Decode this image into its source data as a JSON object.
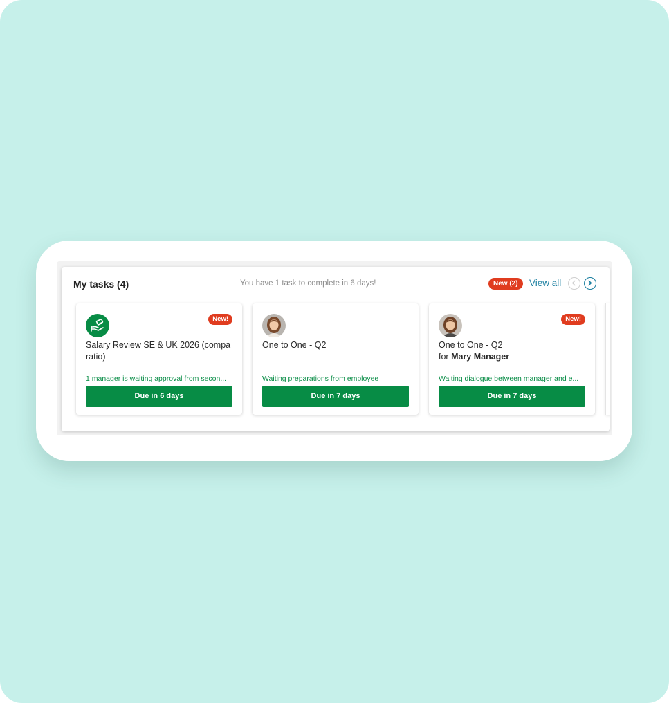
{
  "tasks": {
    "title": "My tasks (4)",
    "subtitle": "You have 1 task to complete in 6 days!",
    "new_badge": "New (2)",
    "view_all": "View all",
    "cards": [
      {
        "new": "New!",
        "title": "Salary Review SE & UK 2026 (compa ratio)",
        "title_line2_prefix": "",
        "title_line2_name": "",
        "status": "1 manager is waiting approval from secon...",
        "due": "Due in 6 days",
        "icon": "salary-hand-icon"
      },
      {
        "new": "",
        "title": "One to One - Q2",
        "title_line2_prefix": "",
        "title_line2_name": "",
        "status": "Waiting preparations from employee",
        "due": "Due in 7 days",
        "icon": "avatar"
      },
      {
        "new": "New!",
        "title": "One to One - Q2",
        "title_line2_prefix": "for ",
        "title_line2_name": "Mary Manager",
        "status": "Waiting dialogue between manager and e...",
        "due": "Due in 7 days",
        "icon": "avatar"
      }
    ]
  },
  "colors": {
    "background": "#c6f0ea",
    "accent_green": "#078c45",
    "badge_red": "#e03c1f",
    "link_blue": "#1b7fa0"
  }
}
